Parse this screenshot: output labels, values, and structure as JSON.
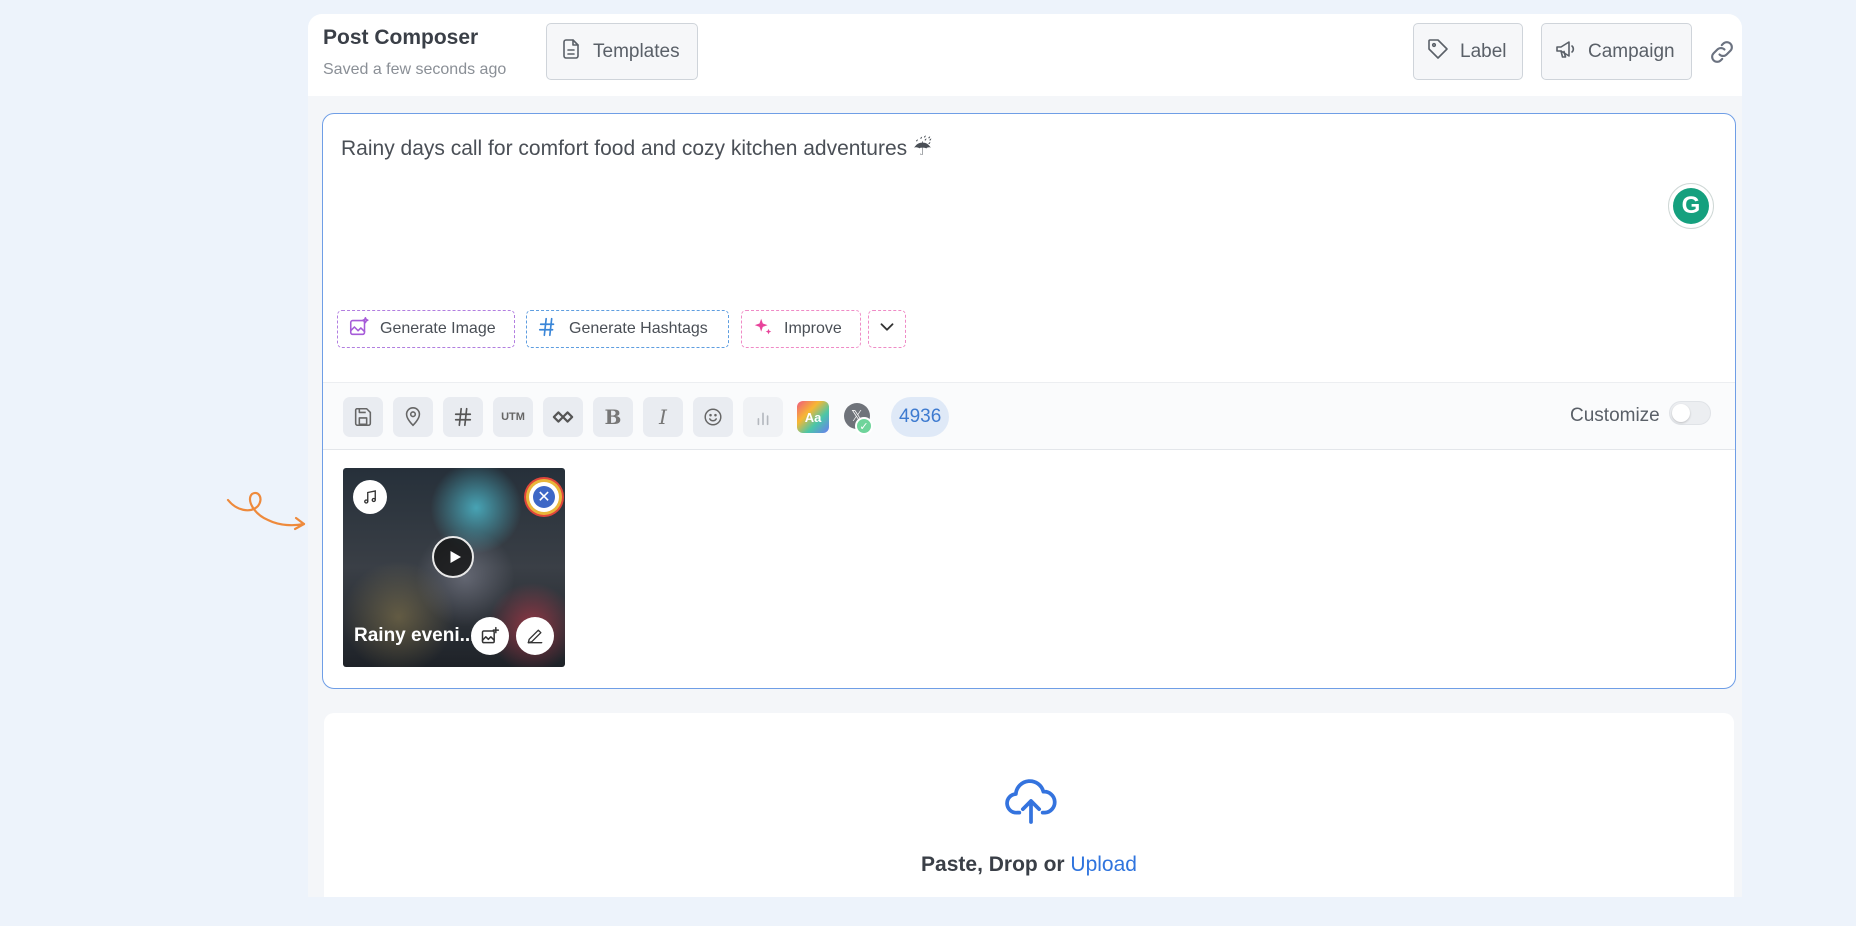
{
  "header": {
    "title": "Post Composer",
    "subtitle": "Saved a few seconds ago",
    "templates_label": "Templates",
    "label_label": "Label",
    "campaign_label": "Campaign"
  },
  "editor": {
    "post_text": "Rainy days call for comfort food and cozy kitchen adventures ☔",
    "grammarly_letter": "G",
    "ai_buttons": {
      "generate_image": "Generate Image",
      "generate_hashtags": "Generate Hashtags",
      "improve": "Improve"
    },
    "toolbar": {
      "utm_label": "UTM",
      "bold_label": "B",
      "italic_label": "I",
      "aa_label": "Aa",
      "x_label": "𝕏",
      "char_count": "4936",
      "customize_label": "Customize"
    },
    "media": {
      "title": "Rainy eveni..."
    }
  },
  "upload": {
    "prefix": "Paste, Drop or ",
    "link": "Upload"
  },
  "colors": {
    "accent": "#2f74de",
    "editor_border": "#6f9ee6",
    "generate_image_border": "#b27ee0",
    "generate_hashtags_border": "#5f9ee0",
    "improve_border": "#ef8bc6",
    "doodle": "#ee8a3c",
    "grammarly": "#15a07e"
  }
}
